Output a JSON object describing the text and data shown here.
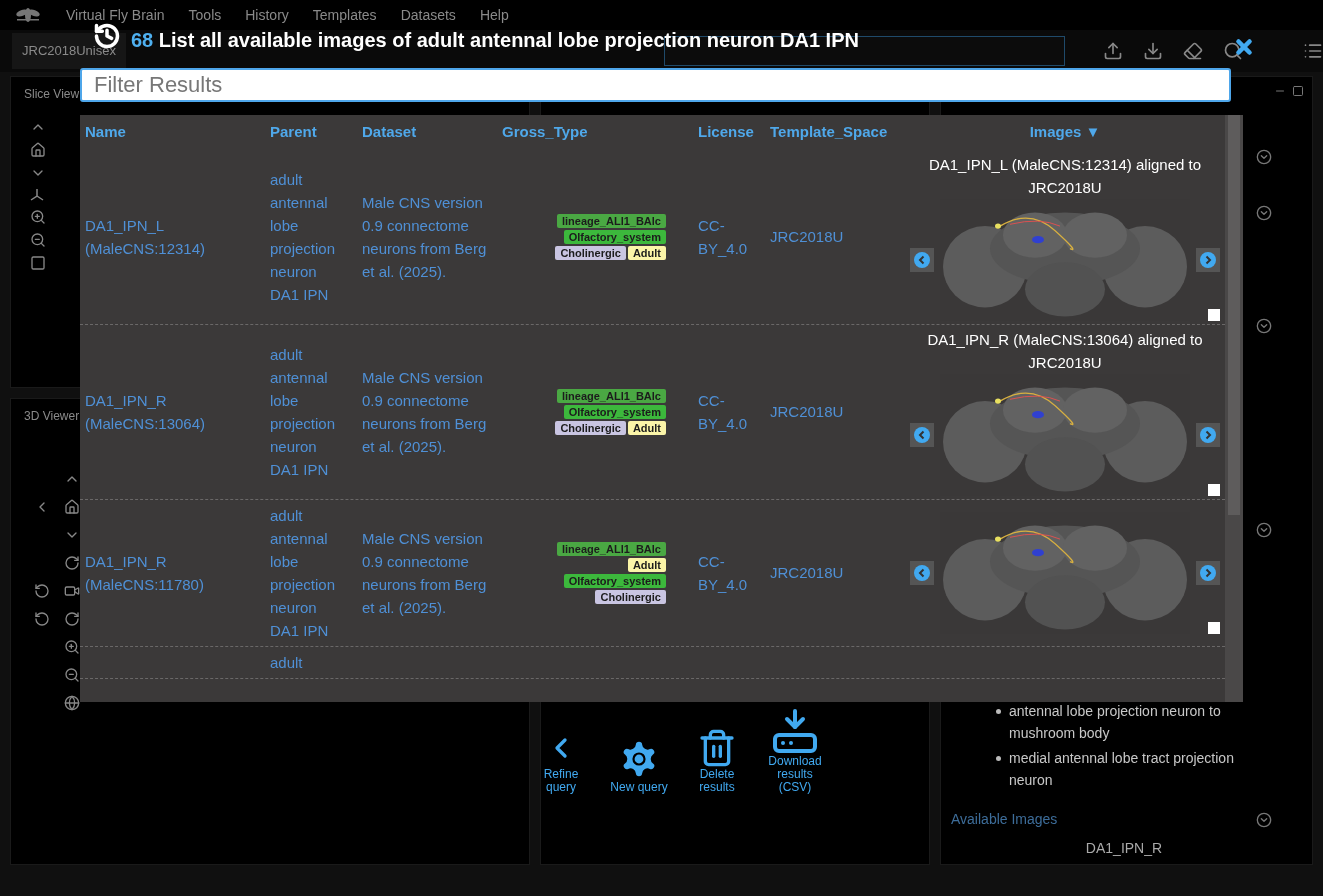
{
  "menu": {
    "items": [
      "Virtual Fly Brain",
      "Tools",
      "History",
      "Templates",
      "Datasets",
      "Help"
    ]
  },
  "workspace_tab": "JRC2018Unisex",
  "panels": {
    "slice_viewer": "Slice View",
    "viewer_3d": "3D Viewer"
  },
  "query_results": {
    "count": "68",
    "title": "List all available images of adult antennal lobe projection neuron DA1 IPN",
    "filter": {
      "placeholder": "Filter Results"
    },
    "columns": [
      "Name",
      "Parent",
      "Dataset",
      "Gross_Type",
      "License",
      "Template_Space",
      "Images ▼"
    ],
    "rows": [
      {
        "name": "DA1_IPN_L (MaleCNS:12314)",
        "parent": "adult antennal lobe projection neuron DA1 IPN",
        "dataset": "Male CNS version 0.9 connectome neurons from Berg et al. (2025).",
        "tags": [
          {
            "label": "lineage_ALl1_BAlc",
            "color": "#4aa843"
          },
          {
            "label": "Olfactory_system",
            "color": "#3cb83c"
          },
          {
            "label": "Cholinergic",
            "color": "#c9c5e2"
          },
          {
            "label": "Adult",
            "color": "#fbf5a8"
          }
        ],
        "license": "CC-BY_4.0",
        "template": "JRC2018U",
        "image": {
          "caption": "DA1_IPN_L (MaleCNS:12314) aligned to JRC2018U",
          "checked": false
        }
      },
      {
        "name": "DA1_IPN_R (MaleCNS:13064)",
        "parent": "adult antennal lobe projection neuron DA1 IPN",
        "dataset": "Male CNS version 0.9 connectome neurons from Berg et al. (2025).",
        "tags": [
          {
            "label": "lineage_ALl1_BAlc",
            "color": "#4aa843"
          },
          {
            "label": "Olfactory_system",
            "color": "#3cb83c"
          },
          {
            "label": "Cholinergic",
            "color": "#c9c5e2"
          },
          {
            "label": "Adult",
            "color": "#fbf5a8"
          }
        ],
        "license": "CC-BY_4.0",
        "template": "JRC2018U",
        "image": {
          "caption": "DA1_IPN_R (MaleCNS:13064) aligned to JRC2018U",
          "checked": false
        }
      },
      {
        "name": "DA1_IPN_R (MaleCNS:11780)",
        "parent": "adult antennal lobe projection neuron DA1 IPN",
        "dataset": "Male CNS version 0.9 connectome neurons from Berg et al. (2025).",
        "tags": [
          {
            "label": "lineage_ALl1_BAlc",
            "color": "#4aa843"
          },
          {
            "label": "Adult",
            "color": "#fbf5a8"
          },
          {
            "label": "Olfactory_system",
            "color": "#3cb83c"
          },
          {
            "label": "Cholinergic",
            "color": "#c9c5e2"
          }
        ],
        "license": "CC-BY_4.0",
        "template": "JRC2018U",
        "image": {
          "checked": false
        }
      },
      {
        "parent": "adult"
      }
    ]
  },
  "query_actions": [
    {
      "kind": "refine",
      "label": "Refine query"
    },
    {
      "kind": "new",
      "label": "New query"
    },
    {
      "kind": "delete",
      "label": "Delete results"
    },
    {
      "kind": "download",
      "label": "Download results (CSV)"
    }
  ],
  "term_info": {
    "list": [
      "antennal lobe projection neuron to mushroom body",
      "medial antennal lobe tract projection neuron"
    ],
    "section": "Available Images",
    "image_name": "DA1_IPN_R"
  }
}
